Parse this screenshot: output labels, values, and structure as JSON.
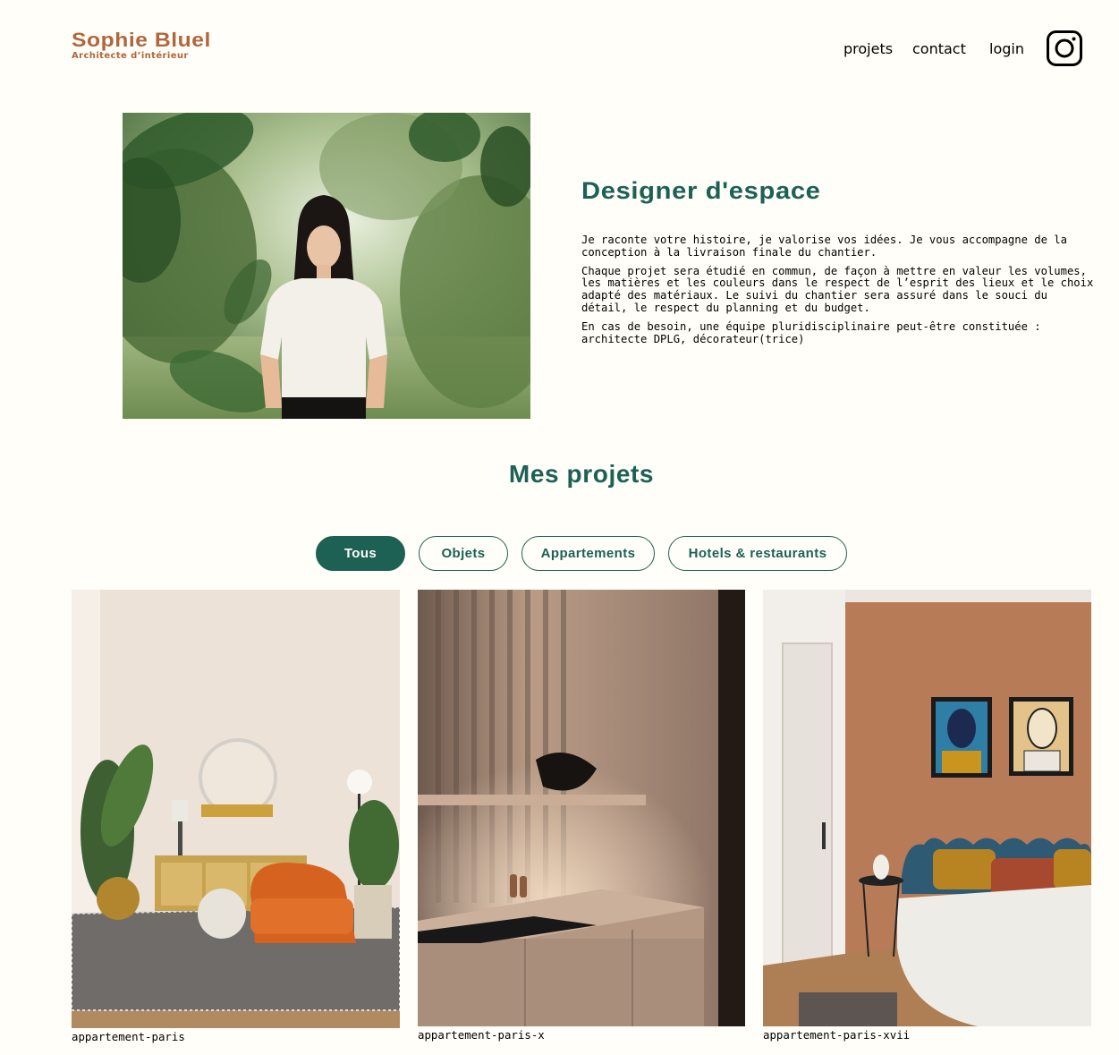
{
  "header": {
    "logo_title": "Sophie Bluel",
    "logo_subtitle": "Architecte d’intérieur",
    "nav": [
      {
        "label": "projets"
      },
      {
        "label": "contact"
      },
      {
        "label": "login"
      }
    ],
    "instagram_icon": "instagram-icon"
  },
  "intro": {
    "title": "Designer d'espace",
    "paragraphs": [
      "Je raconte votre histoire, je valorise vos idées. Je vous accompagne de la conception à la livraison finale du chantier.",
      "Chaque projet sera étudié en commun, de façon à mettre en valeur les volumes, les matières et les couleurs dans le respect de l’esprit des lieux et le choix adapté des matériaux. Le suivi du chantier sera assuré dans le souci du détail, le respect du planning et du budget.",
      "En cas de besoin, une équipe pluridisciplinaire peut-être constituée : architecte DPLG, décorateur(trice)"
    ]
  },
  "projects": {
    "title": "Mes projets",
    "filters": [
      {
        "label": "Tous",
        "active": true
      },
      {
        "label": "Objets",
        "active": false
      },
      {
        "label": "Appartements",
        "active": false
      },
      {
        "label": "Hotels & restaurants",
        "active": false
      }
    ],
    "items": [
      {
        "caption": "appartement-paris"
      },
      {
        "caption": "appartement-paris-x"
      },
      {
        "caption": "appartement-paris-xvii"
      }
    ]
  },
  "colors": {
    "brand": "#B1663C",
    "accent": "#1D6154",
    "background": "#FFFEF8"
  }
}
